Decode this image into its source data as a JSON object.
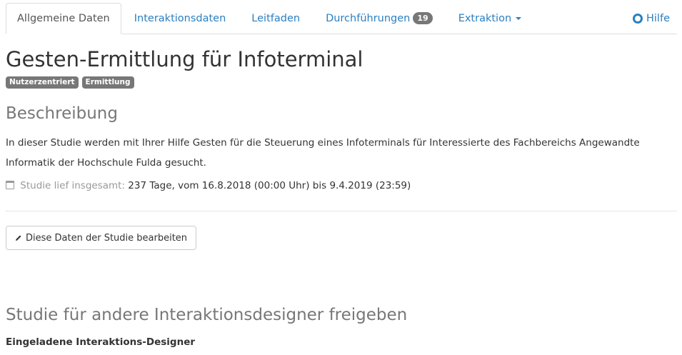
{
  "tabs": [
    {
      "label": "Allgemeine Daten",
      "active": true
    },
    {
      "label": "Interaktionsdaten"
    },
    {
      "label": "Leitfaden"
    },
    {
      "label": "Durchführungen",
      "badge": "19"
    },
    {
      "label": "Extraktion"
    }
  ],
  "help": {
    "label": "Hilfe"
  },
  "study": {
    "title": "Gesten-Ermittlung für Infoterminal",
    "tags": [
      "Nutzerzentriert",
      "Ermittlung"
    ]
  },
  "description": {
    "heading": "Beschreibung",
    "text": "In dieser Studie werden mit Ihrer Hilfe Gesten für die Steuerung eines Infoterminals für Interessierte des Fachbereichs Angewandte Informatik der Hochschule Fulda gesucht.",
    "duration_label": "Studie lief insgesamt:",
    "duration_value": "237 Tage, vom 16.8.2018 (00:00 Uhr) bis 9.4.2019 (23:59)"
  },
  "edit_button": {
    "label": "Diese Daten der Studie bearbeiten"
  },
  "share": {
    "heading": "Studie für andere Interaktionsdesigner freigeben",
    "invited_heading": "Eingeladene Interaktions-Designer"
  },
  "colors": {
    "link": "#2a7fc1",
    "badge": "#777777",
    "muted": "#999999"
  }
}
